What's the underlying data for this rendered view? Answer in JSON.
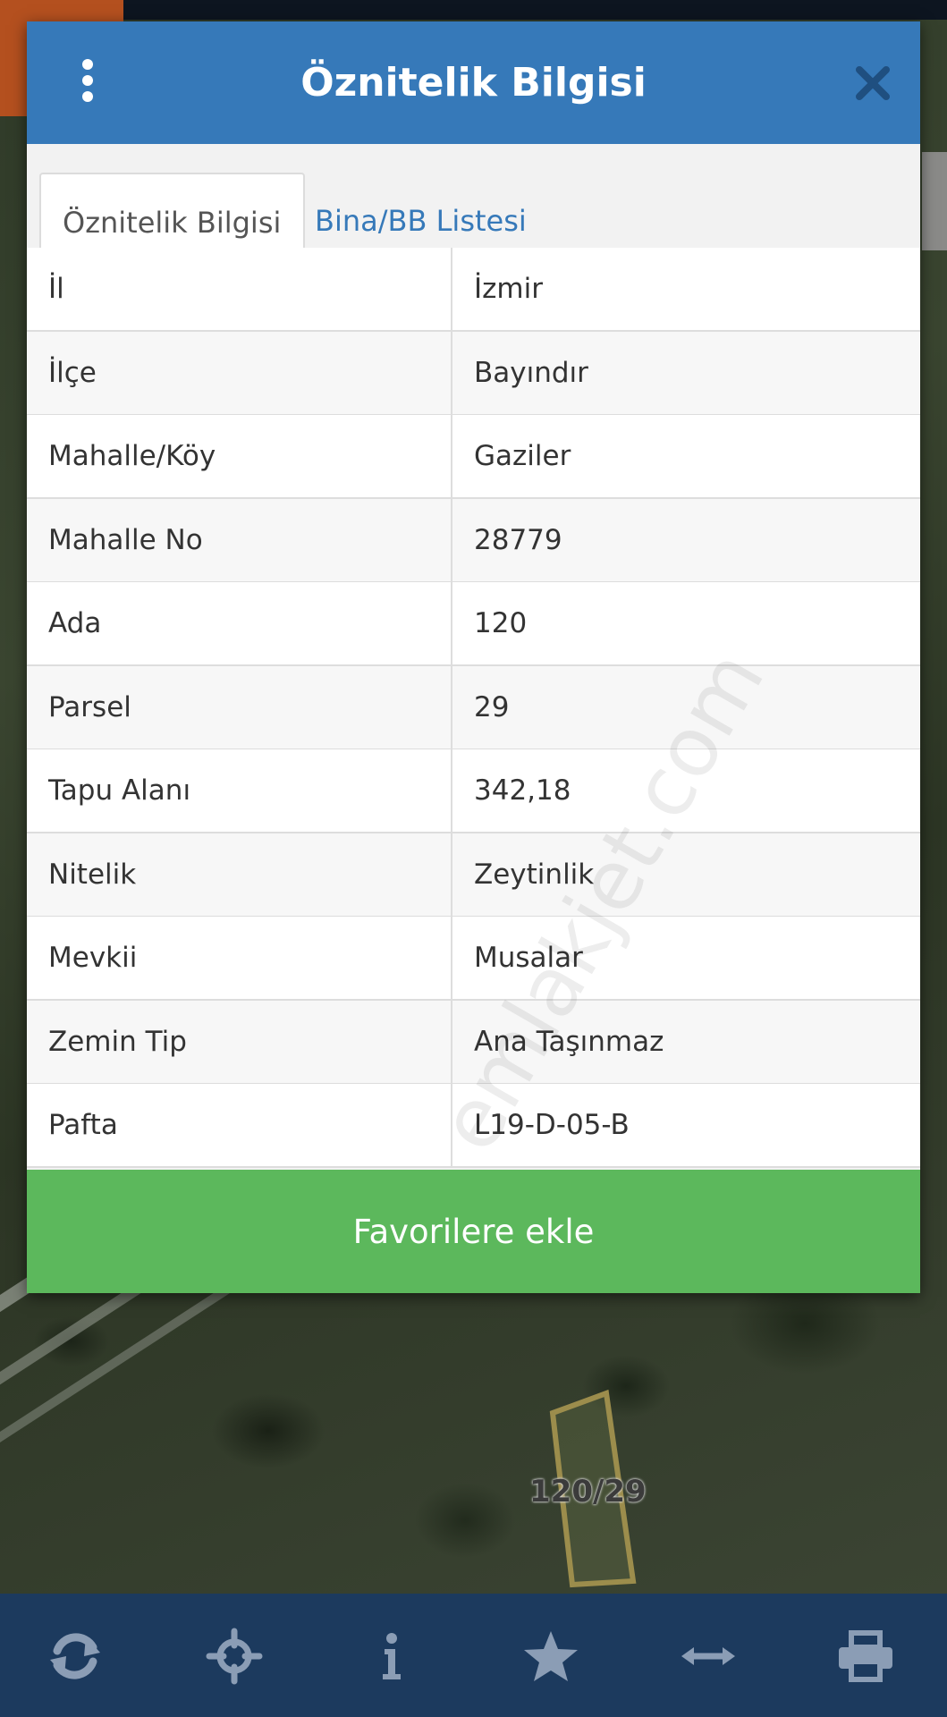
{
  "dialog": {
    "title": "Öznitelik Bilgisi",
    "tabs": [
      {
        "label": "Öznitelik Bilgisi",
        "active": true
      },
      {
        "label": "Bina/BB Listesi",
        "active": false
      }
    ],
    "rows": [
      {
        "key": "İl",
        "value": "İzmir"
      },
      {
        "key": "İlçe",
        "value": "Bayındır"
      },
      {
        "key": "Mahalle/Köy",
        "value": "Gaziler"
      },
      {
        "key": "Mahalle No",
        "value": "28779"
      },
      {
        "key": "Ada",
        "value": "120"
      },
      {
        "key": "Parsel",
        "value": "29"
      },
      {
        "key": "Tapu Alanı",
        "value": "342,18"
      },
      {
        "key": "Nitelik",
        "value": "Zeytinlik"
      },
      {
        "key": "Mevkii",
        "value": "Musalar"
      },
      {
        "key": "Zemin Tip",
        "value": "Ana Taşınmaz"
      },
      {
        "key": "Pafta",
        "value": "L19-D-05-B"
      }
    ],
    "favorite_button": "Favorilere ekle"
  },
  "watermark": "emlakjet.com",
  "map": {
    "parcel_label": "120/29"
  },
  "toolbar": {
    "icons": [
      "refresh-icon",
      "crosshair-icon",
      "info-icon",
      "star-icon",
      "measure-icon",
      "print-icon"
    ]
  },
  "colors": {
    "header": "#3679b9",
    "favorite": "#5cb85c",
    "toolbar": "#1c3a5e",
    "toolbar_icon": "#8b9db5"
  }
}
